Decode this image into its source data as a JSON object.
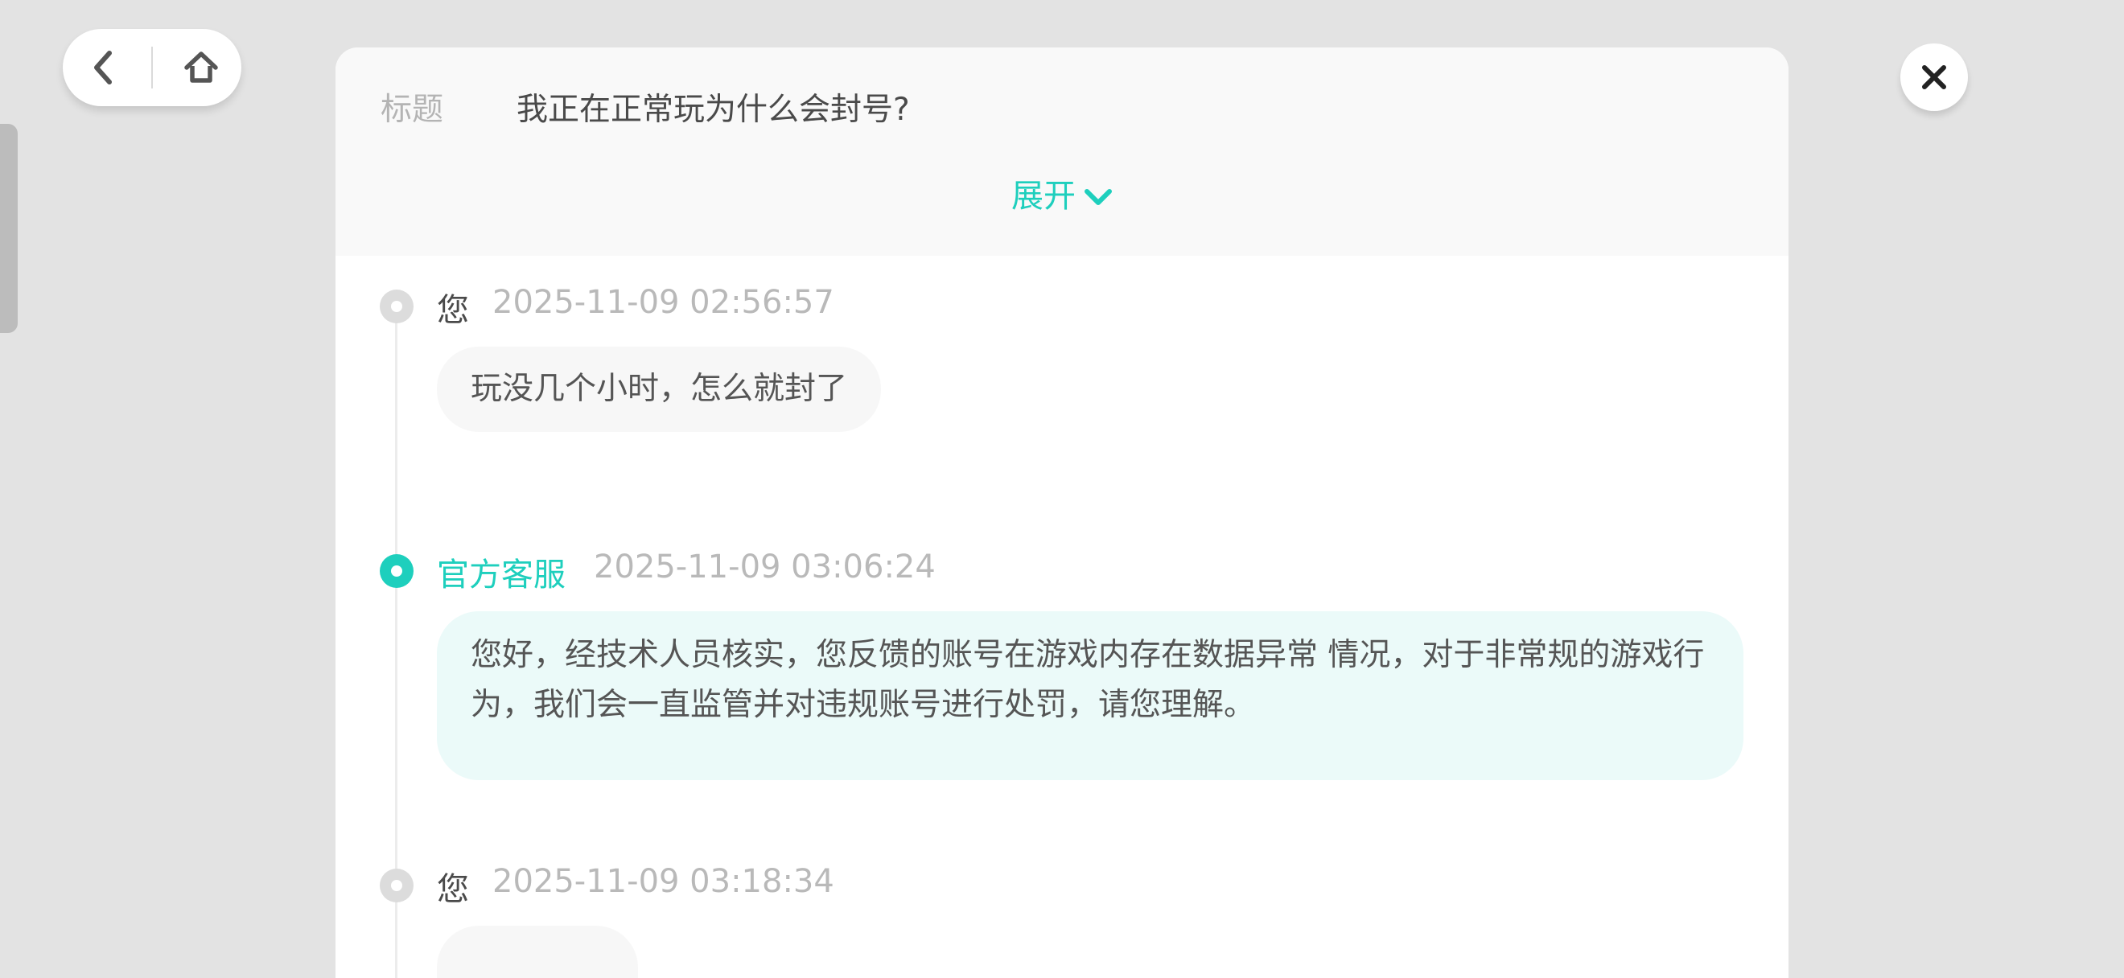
{
  "nav": {
    "back_icon": "chevron-left-icon",
    "home_icon": "home-icon",
    "close_icon": "close-icon"
  },
  "ticket": {
    "title_label": "标题",
    "title_value": "我正在正常玩为什么会封号?",
    "expand_label": "展开"
  },
  "messages": [
    {
      "author": "您",
      "role": "user",
      "time": "2025-11-09 02:56:57",
      "text": "玩没几个小时，怎么就封了"
    },
    {
      "author": "官方客服",
      "role": "staff",
      "time": "2025-11-09 03:06:24",
      "text": "您好，经技术人员核实，您反馈的账号在游戏内存在数据异常 情况，对于非常规的游戏行为，我们会一直监管并对违规账号进行处罚，请您理解。"
    },
    {
      "author": "您",
      "role": "user",
      "time": "2025-11-09 03:18:34",
      "text": ""
    }
  ],
  "colors": {
    "accent": "#1ecfbd",
    "background": "#e3e3e3",
    "staff_bubble": "#ebfaf9",
    "user_bubble": "#f7f7f7"
  }
}
